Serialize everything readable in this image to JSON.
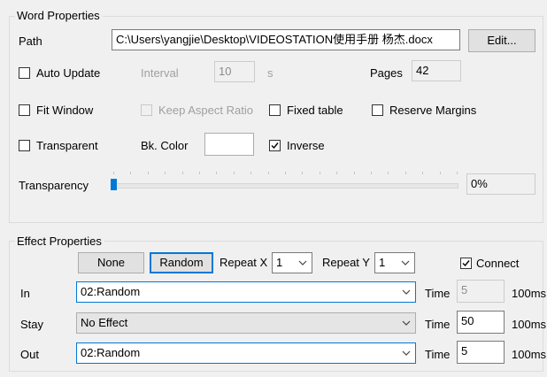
{
  "word_properties": {
    "title": "Word Properties",
    "path_label": "Path",
    "path_value": "C:\\Users\\yangjie\\Desktop\\VIDEOSTATION使用手册 杨杰.docx",
    "edit_button": "Edit...",
    "auto_update_label": "Auto Update",
    "auto_update_checked": false,
    "interval_label": "Interval",
    "interval_value": "10",
    "interval_unit": "s",
    "pages_label": "Pages",
    "pages_value": "42",
    "fit_window_label": "Fit Window",
    "fit_window_checked": false,
    "keep_aspect_label": "Keep Aspect Ratio",
    "keep_aspect_checked": false,
    "fixed_table_label": "Fixed table",
    "fixed_table_checked": false,
    "reserve_margins_label": "Reserve Margins",
    "reserve_margins_checked": false,
    "transparent_label": "Transparent",
    "transparent_checked": false,
    "bk_color_label": "Bk. Color",
    "bk_color_value": "#ffffff",
    "inverse_label": "Inverse",
    "inverse_checked": true,
    "transparency_label": "Transparency",
    "transparency_value": "0%",
    "transparency_level": 0
  },
  "effect_properties": {
    "title": "Effect Properties",
    "none_button": "None",
    "random_button": "Random",
    "repeat_x_label": "Repeat X",
    "repeat_x_value": "1",
    "repeat_y_label": "Repeat Y",
    "repeat_y_value": "1",
    "connect_label": "Connect",
    "connect_checked": true,
    "time_unit": "100ms",
    "rows": [
      {
        "label": "In",
        "effect": "02:Random",
        "time_label": "Time",
        "time": "5",
        "time_enabled": false
      },
      {
        "label": "Stay",
        "effect": "No Effect",
        "time_label": "Time",
        "time": "50",
        "time_enabled": true
      },
      {
        "label": "Out",
        "effect": "02:Random",
        "time_label": "Time",
        "time": "5",
        "time_enabled": true
      }
    ]
  },
  "colors": {
    "accent": "#0078d7",
    "window_bg": "#f0f0f0"
  }
}
